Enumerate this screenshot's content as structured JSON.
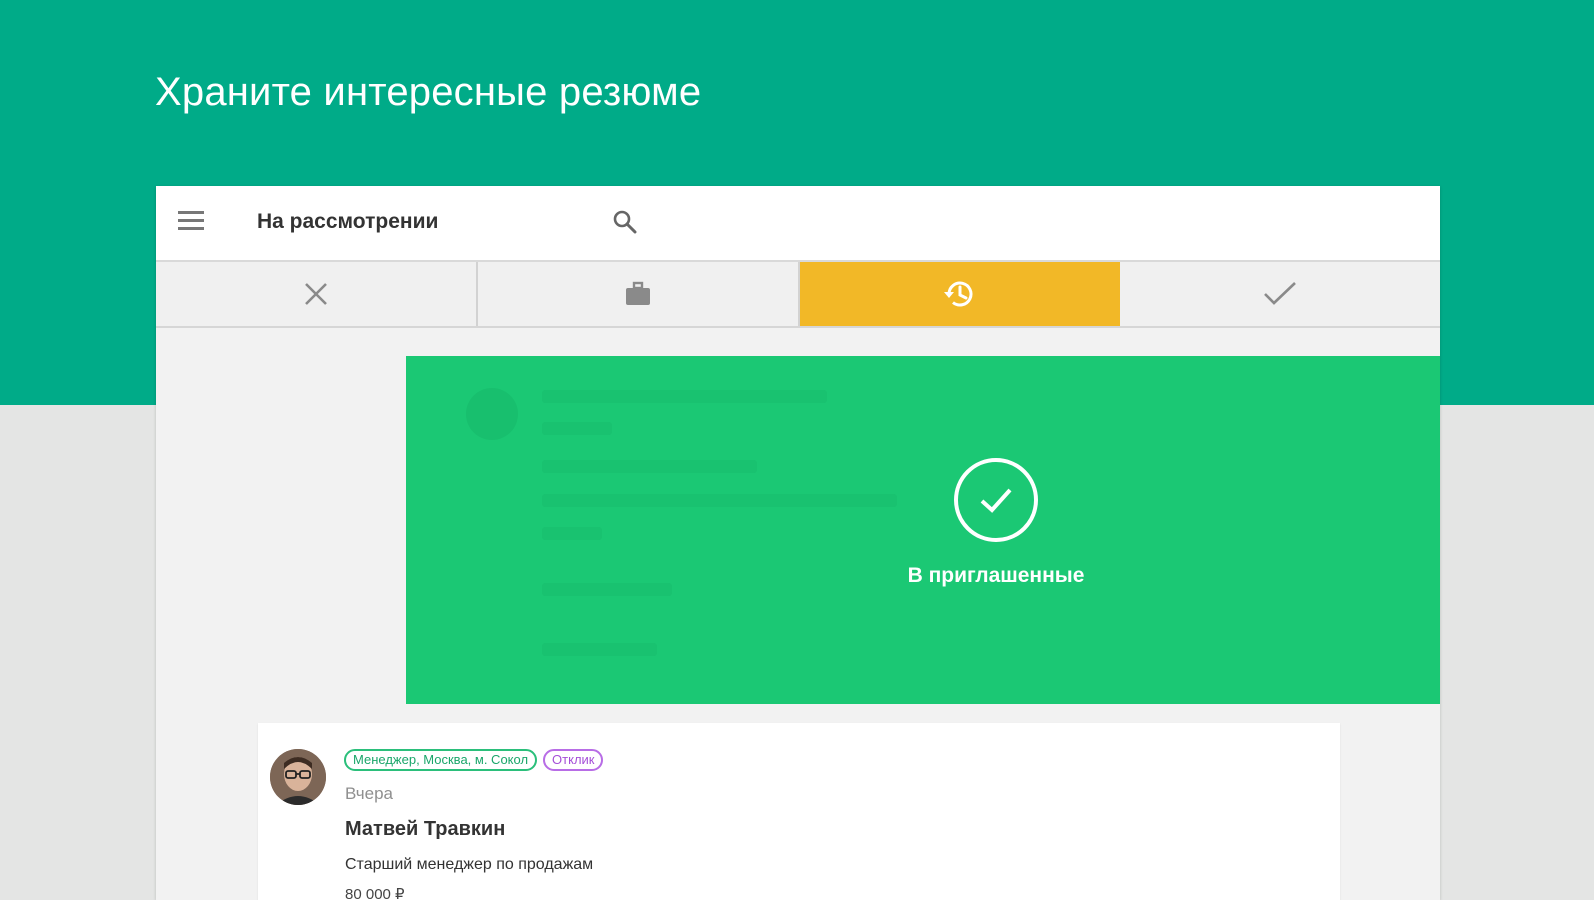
{
  "hero": {
    "title": "Храните интересные резюме"
  },
  "toolbar": {
    "menu_icon": "menu-icon",
    "title": "На рассмотрении",
    "search_icon": "search-icon"
  },
  "tabs": [
    {
      "icon": "close-icon",
      "active": false
    },
    {
      "icon": "briefcase-icon",
      "active": false
    },
    {
      "icon": "history-icon",
      "active": true
    },
    {
      "icon": "check-icon",
      "active": false
    }
  ],
  "swipe_card": {
    "action_icon": "check-circle-icon",
    "action_label": "В приглашенные"
  },
  "resume": {
    "tags": [
      "Менеджер, Москва, м. Сокол",
      "Отклик"
    ],
    "date": "Вчера",
    "name": "Матвей Травкин",
    "position": "Старший менеджер по продажам",
    "salary": "80 000 ₽"
  },
  "colors": {
    "hero_bg": "#00ab88",
    "active_tab": "#f2b827",
    "swipe_card_bg": "#1bc874",
    "tag_green": "#2bbf7b",
    "tag_purple": "#b86de6"
  }
}
